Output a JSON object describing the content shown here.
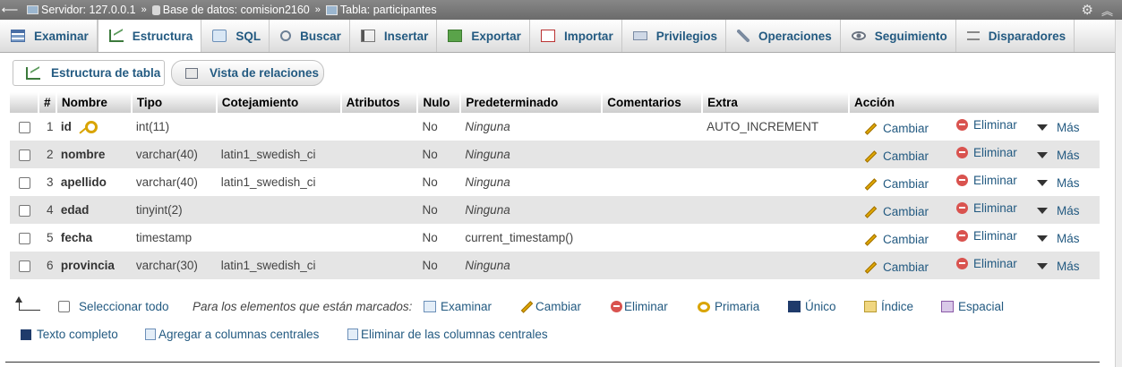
{
  "breadcrumb": {
    "server": "Servidor: 127.0.0.1",
    "database": "Base de datos: comision2160",
    "table": "Tabla: participantes",
    "separator": "»"
  },
  "tabs": [
    {
      "label": "Examinar",
      "icon": "browse-icon"
    },
    {
      "label": "Estructura",
      "icon": "structure-icon",
      "active": true
    },
    {
      "label": "SQL",
      "icon": "sql-icon"
    },
    {
      "label": "Buscar",
      "icon": "search-icon"
    },
    {
      "label": "Insertar",
      "icon": "insert-icon"
    },
    {
      "label": "Exportar",
      "icon": "export-icon"
    },
    {
      "label": "Importar",
      "icon": "import-icon"
    },
    {
      "label": "Privilegios",
      "icon": "privileges-icon"
    },
    {
      "label": "Operaciones",
      "icon": "operations-icon"
    },
    {
      "label": "Seguimiento",
      "icon": "tracking-icon"
    },
    {
      "label": "Disparadores",
      "icon": "triggers-icon"
    }
  ],
  "subtabs": {
    "table_structure": "Estructura de tabla",
    "relations_view": "Vista de relaciones"
  },
  "table": {
    "headers": [
      "#",
      "Nombre",
      "Tipo",
      "Cotejamiento",
      "Atributos",
      "Nulo",
      "Predeterminado",
      "Comentarios",
      "Extra",
      "Acción"
    ],
    "rows": [
      {
        "num": "1",
        "name": "id",
        "type": "int(11)",
        "collation": "",
        "attributes": "",
        "null": "No",
        "default": "Ninguna",
        "default_italic": true,
        "comments": "",
        "extra": "AUTO_INCREMENT",
        "primary_key": true
      },
      {
        "num": "2",
        "name": "nombre",
        "type": "varchar(40)",
        "collation": "latin1_swedish_ci",
        "attributes": "",
        "null": "No",
        "default": "Ninguna",
        "default_italic": true,
        "comments": "",
        "extra": ""
      },
      {
        "num": "3",
        "name": "apellido",
        "type": "varchar(40)",
        "collation": "latin1_swedish_ci",
        "attributes": "",
        "null": "No",
        "default": "Ninguna",
        "default_italic": true,
        "comments": "",
        "extra": ""
      },
      {
        "num": "4",
        "name": "edad",
        "type": "tinyint(2)",
        "collation": "",
        "attributes": "",
        "null": "No",
        "default": "Ninguna",
        "default_italic": true,
        "comments": "",
        "extra": ""
      },
      {
        "num": "5",
        "name": "fecha",
        "type": "timestamp",
        "collation": "",
        "attributes": "",
        "null": "No",
        "default": "current_timestamp()",
        "default_italic": false,
        "comments": "",
        "extra": ""
      },
      {
        "num": "6",
        "name": "provincia",
        "type": "varchar(30)",
        "collation": "latin1_swedish_ci",
        "attributes": "",
        "null": "No",
        "default": "Ninguna",
        "default_italic": true,
        "comments": "",
        "extra": ""
      }
    ],
    "actions": {
      "change": "Cambiar",
      "drop": "Eliminar",
      "more": "Más"
    }
  },
  "footer": {
    "select_all": "Seleccionar todo",
    "with_selected": "Para los elementos que están marcados:",
    "browse": "Examinar",
    "change": "Cambiar",
    "drop": "Eliminar",
    "primary": "Primaria",
    "unique": "Único",
    "index": "Índice",
    "spatial": "Espacial",
    "fulltext": "Texto completo",
    "add_central": "Agregar a columnas centrales",
    "remove_central": "Eliminar de las columnas centrales"
  },
  "colors": {
    "link": "#235a81",
    "topbar": "#787878",
    "row_even": "#e5e5e5"
  }
}
